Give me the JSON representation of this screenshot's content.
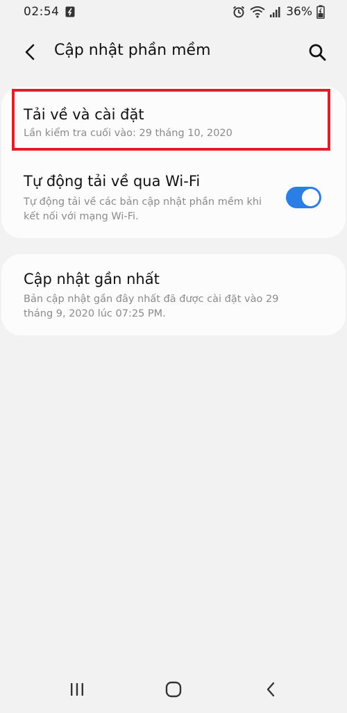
{
  "status_bar": {
    "time": "02:54",
    "battery_percent": "36%",
    "icons": [
      "sync-icon",
      "alarm-icon",
      "wifi-icon",
      "signal-icon",
      "battery-icon"
    ]
  },
  "header": {
    "title": "Cập nhật phần mềm",
    "back_icon": "back-arrow-icon",
    "search_icon": "search-icon"
  },
  "settings": {
    "download_install": {
      "title": "Tải về và cài đặt",
      "subtitle": "Lần kiểm tra cuối vào: 29 tháng 10, 2020"
    },
    "auto_download": {
      "title": "Tự động tải về qua Wi-Fi",
      "subtitle": "Tự động tải về các bản cập nhật phần mềm khi kết nối với mạng Wi-Fi.",
      "enabled": true
    },
    "last_update": {
      "title": "Cập nhật gần nhất",
      "subtitle": "Bản cập nhật gần đây nhất đã được cài đặt vào 29 tháng 9, 2020 lúc 07:25 PM."
    }
  },
  "colors": {
    "background": "#f2f2f2",
    "card": "#fcfcfc",
    "toggle_on": "#2a7ee6",
    "highlight": "#e11d2a",
    "subtitle": "#8a8a8a"
  },
  "nav_bar": {
    "icons": [
      "recent-apps-icon",
      "home-icon",
      "back-icon"
    ]
  }
}
